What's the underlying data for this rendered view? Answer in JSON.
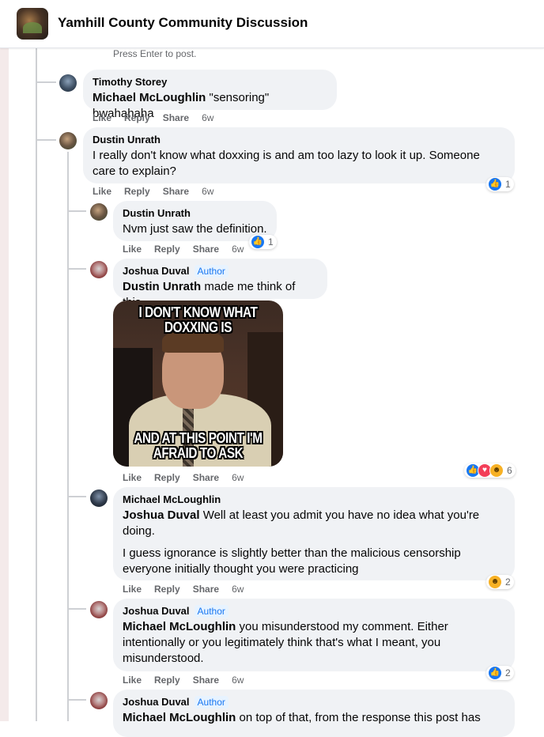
{
  "header": {
    "group_title": "Yamhill County Community Discussion"
  },
  "press_enter": "Press Enter to post.",
  "actions": {
    "like": "Like",
    "reply": "Reply",
    "share": "Share"
  },
  "comments": [
    {
      "author": "Timothy Storey",
      "mention": "Michael McLoughlin",
      "text": " \"sensoring\" bwahahaha",
      "time": "6w"
    },
    {
      "author": "Dustin Unrath",
      "text": "I really don't know what doxxing is and am too lazy to look it up. Someone care to explain?",
      "time": "6w",
      "reaction_count": "1"
    },
    {
      "author": "Dustin Unrath",
      "text": "Nvm just saw the definition.",
      "time": "6w",
      "reaction_count": "1"
    },
    {
      "author": "Joshua Duval",
      "badge": "Author",
      "mention": "Dustin Unrath",
      "text": " made me think of this.",
      "time": "6w",
      "reaction_count": "6",
      "meme_top": "I DON'T KNOW WHAT DOXXING IS",
      "meme_bottom": "AND AT THIS POINT I'M AFRAID TO ASK"
    },
    {
      "author": "Michael McLoughlin",
      "mention": "Joshua Duval",
      "text": " Well at least you admit you have no idea what you're doing.",
      "text2": "I guess ignorance is slightly better than the malicious censorship everyone initially thought you were practicing",
      "time": "6w",
      "reaction_count": "2"
    },
    {
      "author": "Joshua Duval",
      "badge": "Author",
      "mention": "Michael McLoughlin",
      "text": " you misunderstood my comment. Either intentionally or you legitimately think that's what I meant, you misunderstood.",
      "time": "6w",
      "reaction_count": "2"
    },
    {
      "author": "Joshua Duval",
      "badge": "Author",
      "mention": "Michael McLoughlin",
      "text": " on top of that, from the response this post has"
    }
  ],
  "colors": {
    "like_blue": "#1877f2",
    "bubble_bg": "#f0f2f5",
    "meta_gray": "#65676b"
  }
}
